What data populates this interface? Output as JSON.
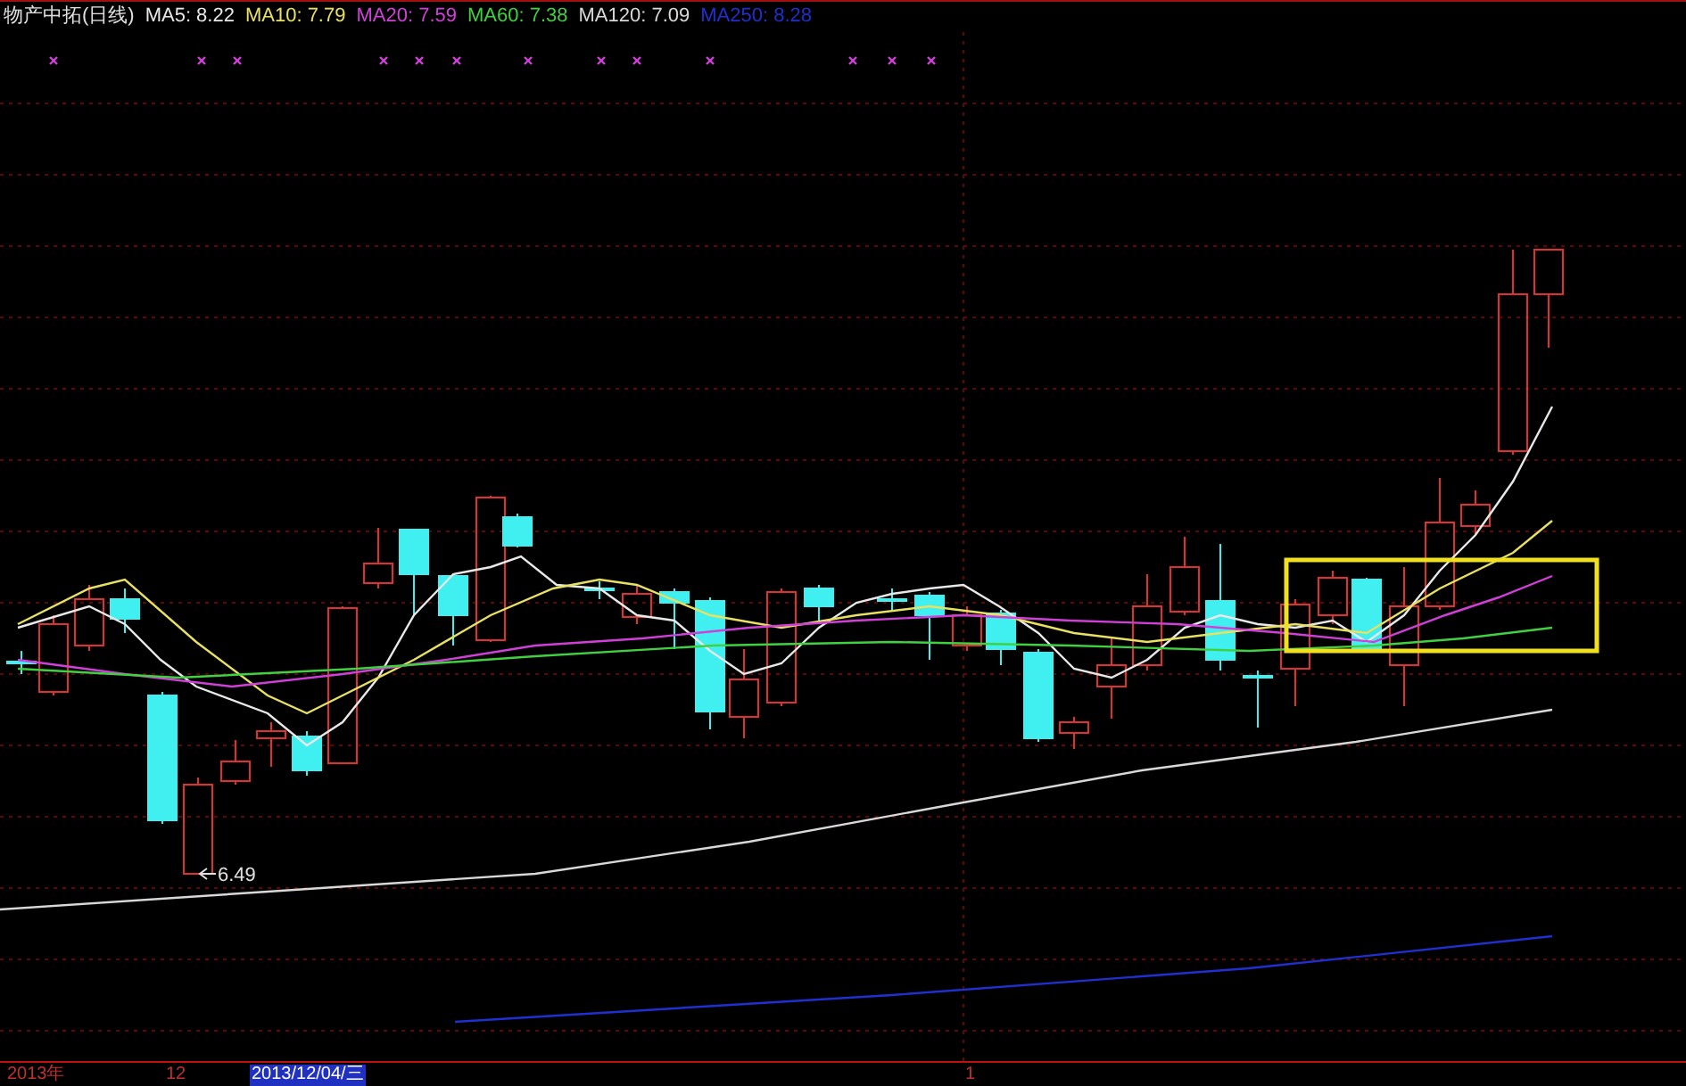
{
  "title": "物产中拓(日线)",
  "ma_legend": [
    {
      "label": "MA5: 8.22",
      "color": "#e8e8e8"
    },
    {
      "label": "MA10: 7.79",
      "color": "#e8e060"
    },
    {
      "label": "MA20: 7.59",
      "color": "#d040d8"
    },
    {
      "label": "MA60: 7.38",
      "color": "#40d040"
    },
    {
      "label": "MA120: 7.09",
      "color": "#d8d8d8"
    },
    {
      "label": "MA250: 8.28",
      "color": "#2030d0"
    }
  ],
  "low_marker": "6.49",
  "time_axis": [
    {
      "label": "2013年",
      "selected": false
    },
    {
      "label": "12",
      "selected": false
    },
    {
      "label": "2013/12/04/三",
      "selected": true
    },
    {
      "label": "1",
      "selected": false
    }
  ]
}
